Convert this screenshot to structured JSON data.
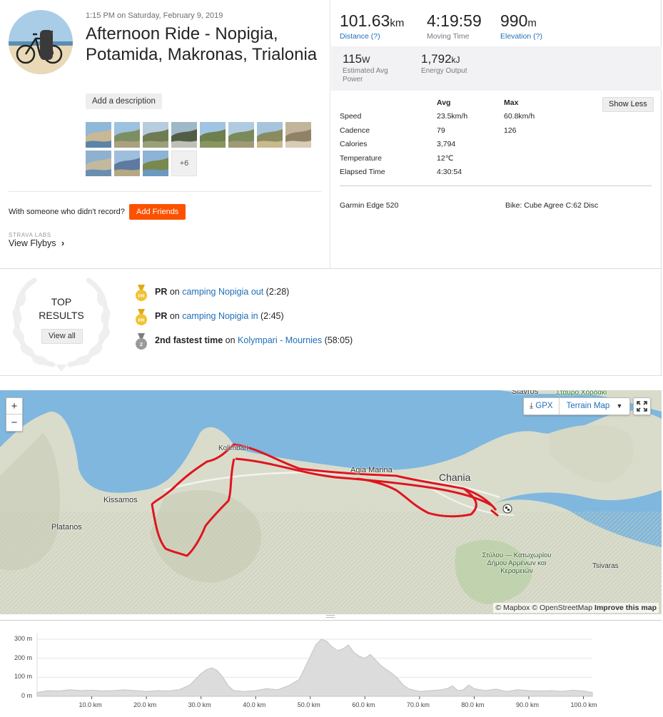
{
  "activity": {
    "datetime": "1:15 PM on Saturday, February 9, 2019",
    "title": "Afternoon Ride - Nopigia, Potamida, Makronas, Trialonia",
    "add_description": "Add a description",
    "more_photos": "+6",
    "with_someone": "With someone who didn't record?",
    "add_friends": "Add Friends",
    "strava_labs": "STRAVA LABS",
    "view_flybys": "View Flybys"
  },
  "stats": {
    "distance": {
      "value": "101.63",
      "unit": "km",
      "label": "Distance (?)"
    },
    "moving_time": {
      "value": "4:19:59",
      "label": "Moving Time"
    },
    "elevation": {
      "value": "990",
      "unit": "m",
      "label": "Elevation (?)"
    },
    "power": {
      "value": "115",
      "unit": "W",
      "label": "Estimated Avg Power"
    },
    "energy": {
      "value": "1,792",
      "unit": "kJ",
      "label": "Energy Output"
    },
    "show_less": "Show Less",
    "col_avg": "Avg",
    "col_max": "Max",
    "rows": [
      {
        "name": "Speed",
        "avg": "23.5km/h",
        "max": "60.8km/h"
      },
      {
        "name": "Cadence",
        "avg": "79",
        "max": "126"
      },
      {
        "name": "Calories",
        "avg": "3,794",
        "max": ""
      },
      {
        "name": "Temperature",
        "avg": "12℃",
        "max": ""
      },
      {
        "name": "Elapsed Time",
        "avg": "4:30:54",
        "max": ""
      }
    ],
    "device": "Garmin Edge 520",
    "bike": "Bike: Cube Agree C:62 Disc"
  },
  "top_results": {
    "title_line1": "TOP",
    "title_line2": "RESULTS",
    "view_all": "View all",
    "items": [
      {
        "medal": "PR",
        "badge": "PR",
        "prefix": " on ",
        "segment": "camping Nopigia out",
        "time": " (2:28)"
      },
      {
        "medal": "PR",
        "badge": "PR",
        "prefix": " on ",
        "segment": "camping Nopigia in",
        "time": " (2:45)"
      },
      {
        "medal": "2",
        "badge": "2nd fastest time",
        "prefix": " on ",
        "segment": "Kolympari - Mournies",
        "time": " (58:05)"
      }
    ]
  },
  "map": {
    "zoom_in": "+",
    "zoom_out": "−",
    "gpx": "GPX",
    "terrain": "Terrain Map",
    "labels": {
      "stavros": "Stavros",
      "stavros_greek": "Σταυρό Χορδάκι",
      "kolymbari": "Kolimbari",
      "kissamos": "Kissamos",
      "platanos": "Platanos",
      "agia_marina": "Agia Marina",
      "chania": "Chania",
      "tsivaras": "Tsivaras",
      "greek_area": "Στύλου — Κατωχωρίου Δήμου Αρμένων και Κεραμειών"
    },
    "attribution_1": "© Mapbox © OpenStreetMap",
    "attribution_2": "Improve this map",
    "colors": {
      "route": "#e0141e",
      "water": "#7fb7de",
      "land": "#d8dccb"
    }
  },
  "elevation_chart": {
    "y_ticks": [
      "300 m",
      "200 m",
      "100 m",
      "0 m"
    ],
    "x_ticks": [
      "10.0 km",
      "20.0 km",
      "30.0 km",
      "40.0 km",
      "50.0 km",
      "60.0 km",
      "70.0 km",
      "80.0 km",
      "90.0 km",
      "100.0 km"
    ]
  },
  "chart_data": {
    "type": "area",
    "xlabel": "",
    "ylabel": "",
    "ylim": [
      0,
      330
    ],
    "xlim": [
      0,
      101.63
    ],
    "x": [
      0,
      2,
      4,
      6,
      8,
      10,
      12,
      14,
      16,
      18,
      20,
      22,
      24,
      26,
      28,
      29,
      30,
      31,
      32,
      33,
      34,
      35,
      36,
      38,
      40,
      42,
      44,
      46,
      48,
      49,
      50,
      51,
      52,
      53,
      54,
      55,
      56,
      57,
      58,
      59,
      60,
      61,
      62,
      63,
      64,
      65,
      66,
      67,
      68,
      70,
      72,
      74,
      75,
      76,
      77,
      78,
      79,
      80,
      82,
      84,
      86,
      88,
      90,
      92,
      94,
      96,
      98,
      100,
      101.63
    ],
    "series": [
      {
        "values": [
          20,
          30,
          28,
          35,
          30,
          32,
          28,
          30,
          34,
          30,
          26,
          30,
          28,
          35,
          60,
          90,
          120,
          140,
          150,
          135,
          100,
          55,
          30,
          25,
          30,
          40,
          35,
          55,
          90,
          150,
          210,
          270,
          300,
          290,
          260,
          240,
          250,
          270,
          230,
          210,
          200,
          220,
          190,
          160,
          140,
          120,
          95,
          60,
          40,
          25,
          30,
          35,
          40,
          55,
          30,
          35,
          60,
          40,
          30,
          38,
          25,
          35,
          30,
          28,
          30,
          26,
          32,
          28,
          20
        ]
      }
    ],
    "grid": true
  }
}
